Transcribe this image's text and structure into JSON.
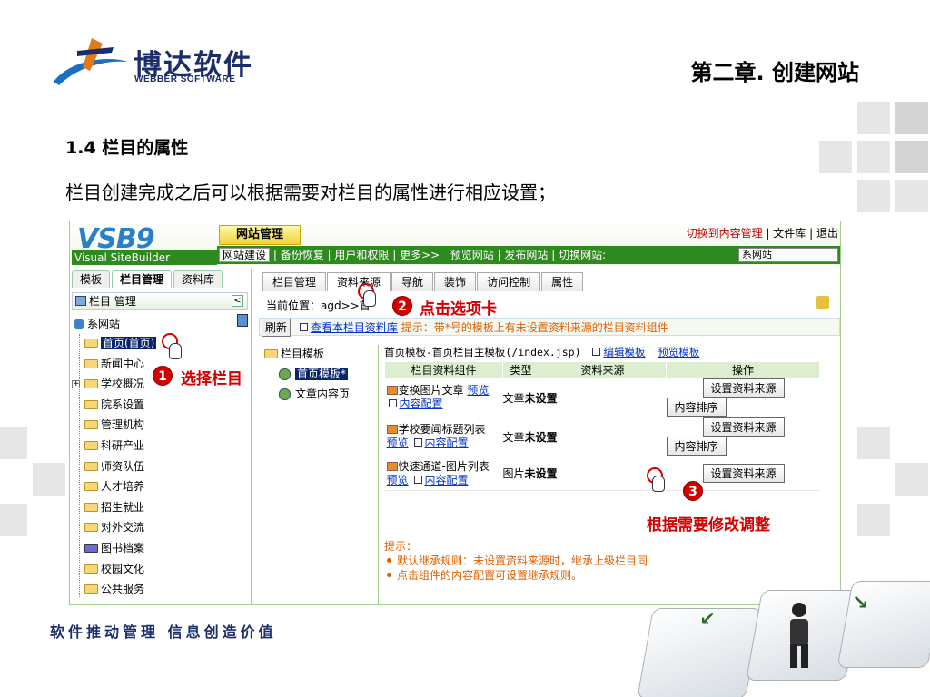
{
  "slide": {
    "logo_cn": "博达软件",
    "logo_en": "WEBBER SOFTWARE",
    "chapter": "第二章. 创建网站",
    "section_title": "1.4 栏目的属性",
    "section_desc": "栏目创建完成之后可以根据需要对栏目的属性进行相应设置；",
    "slogan": "软件推动管理 信息创造价值"
  },
  "app": {
    "logo": "VSB9",
    "logo_sub": "Visual SiteBuilder",
    "main_tab": "网站管理",
    "top_links": [
      "切换到内容管理",
      "文件库",
      "退出"
    ],
    "menu": [
      "网站建设",
      "备份恢复",
      "用户和权限",
      "更多>>",
      "预览网站",
      "发布网站",
      "切换网站:"
    ],
    "site_select": "系网站"
  },
  "left": {
    "tabs": [
      "模板",
      "栏目管理",
      "资料库"
    ],
    "panel_title": "栏目 管理",
    "root": "系网站",
    "items": [
      "首页(首页)",
      "新闻中心",
      "学校概况",
      "院系设置",
      "管理机构",
      "科研产业",
      "师资队伍",
      "人才培养",
      "招生就业",
      "对外交流",
      "图书档案",
      "校园文化",
      "公共服务"
    ]
  },
  "right": {
    "tabs": [
      "栏目管理",
      "资料来源",
      "导航",
      "装饰",
      "访问控制",
      "属性"
    ],
    "path_prefix": "当前位置：agd>>首",
    "refresh": "刷新",
    "view_lib": "查看本栏目资料库",
    "hint": "提示：带*号的模板上有未设置资料来源的栏目资料组件",
    "tpl_root": "栏目模板",
    "tpl_items": [
      "首页模板*",
      "文章内容页"
    ],
    "tpl_title": "首页模板-首页栏目主模板(/index.jsp)",
    "edit_tpl": "编辑模板",
    "preview_tpl": "预览模板",
    "headers": [
      "栏目资料组件",
      "类型",
      "资料来源",
      "操作"
    ],
    "rows": [
      {
        "name": "变换图片文章",
        "preview": "预览",
        "config": "内容配置",
        "type": "文章",
        "source": "未设置",
        "btn1": "设置资料来源",
        "btn2": "内容排序"
      },
      {
        "name": "学校要闻标题列表",
        "preview": "预览",
        "config": "内容配置",
        "type": "文章",
        "source": "未设置",
        "btn1": "设置资料来源",
        "btn2": "内容排序"
      },
      {
        "name": "快速通道-图片列表",
        "preview": "预览",
        "config": "内容配置",
        "type": "图片",
        "source": "未设置",
        "btn1": "设置资料来源",
        "btn2": ""
      }
    ],
    "tips_title": "提示：",
    "tips": [
      "默认继承规则：未设置资料来源时，继承上级栏目同",
      "点击组件的内容配置可设置继承规则。"
    ]
  },
  "annotations": {
    "a1_num": "1",
    "a1_text": "选择栏目",
    "a2_num": "2",
    "a2_text": "点击选项卡",
    "a3_num": "3",
    "a3_text": "根据需要修改调整"
  }
}
